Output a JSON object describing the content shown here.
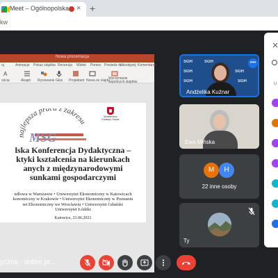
{
  "browser": {
    "tab_title": "Meet – Ogólnopolska konfe",
    "close_glyph": "×",
    "new_tab_glyph": "+",
    "url_fragment": "kw"
  },
  "presentation": {
    "window_title": "Nowa prezentacja",
    "ribbon_tabs": [
      "oj",
      "Animacje",
      "Pokaz slajdów",
      "Recenzja",
      "Widok",
      "Pomoc",
      "Powiedz mi",
      "Udostępnij",
      "Komentarze"
    ],
    "ribbon_labels": [
      "ościa",
      "Akapit",
      "Rysowanie",
      "Głos",
      "Projektant",
      "Nowa ze slajdu",
      "Wyróżnianie wspólnych slajdów"
    ],
    "slide": {
      "arc_text": "najlepsza praca z zakresu",
      "logo_letters": "MSG",
      "ministry_label": "Ministerstwo Edukacji i Nauki",
      "heading_lines": [
        "lska Konferencja Dydaktyczna –",
        "ktyki kształcenia na kierunkach",
        "anych z międzynarodowymi",
        "sunkami gospodarczymi"
      ],
      "universities_lines": [
        "ndlowa w Warszawie • Uniwersytet Ekonomiczny w Katowicach",
        "konomiczny w Krakowie • Uniwersytet Ekonomiczny w Poznaniu",
        "tet Ekonomiczny we Wrocławiu • Uniwersytet Gdański",
        "Uniwersytet Łódzki"
      ],
      "date": "Katowice, 23.06.2021"
    }
  },
  "participants": [
    {
      "name": "Andżelika Kuźnar",
      "background_text": "SGH",
      "more_glyph": "•••",
      "accent": "#1a73e8"
    },
    {
      "name": "Ewa Mińska"
    },
    {
      "label": "22 inne osoby",
      "avatar_letters": [
        "M",
        "H"
      ],
      "avatar_colors": [
        "#e8710a",
        "#4285f4"
      ]
    },
    {
      "name": "Ty"
    }
  ],
  "side_panel": {
    "heading_letter": "U",
    "avatar_colors": [
      "#a142f4",
      "#e37400",
      "#a142f4",
      "#a142f4",
      "#12b5cb",
      "#12b5cb",
      "#1a73e8"
    ]
  },
  "bottom_bar": {
    "meeting_title": "yczna - dobre pr...",
    "end_call_color": "#ea4335"
  }
}
